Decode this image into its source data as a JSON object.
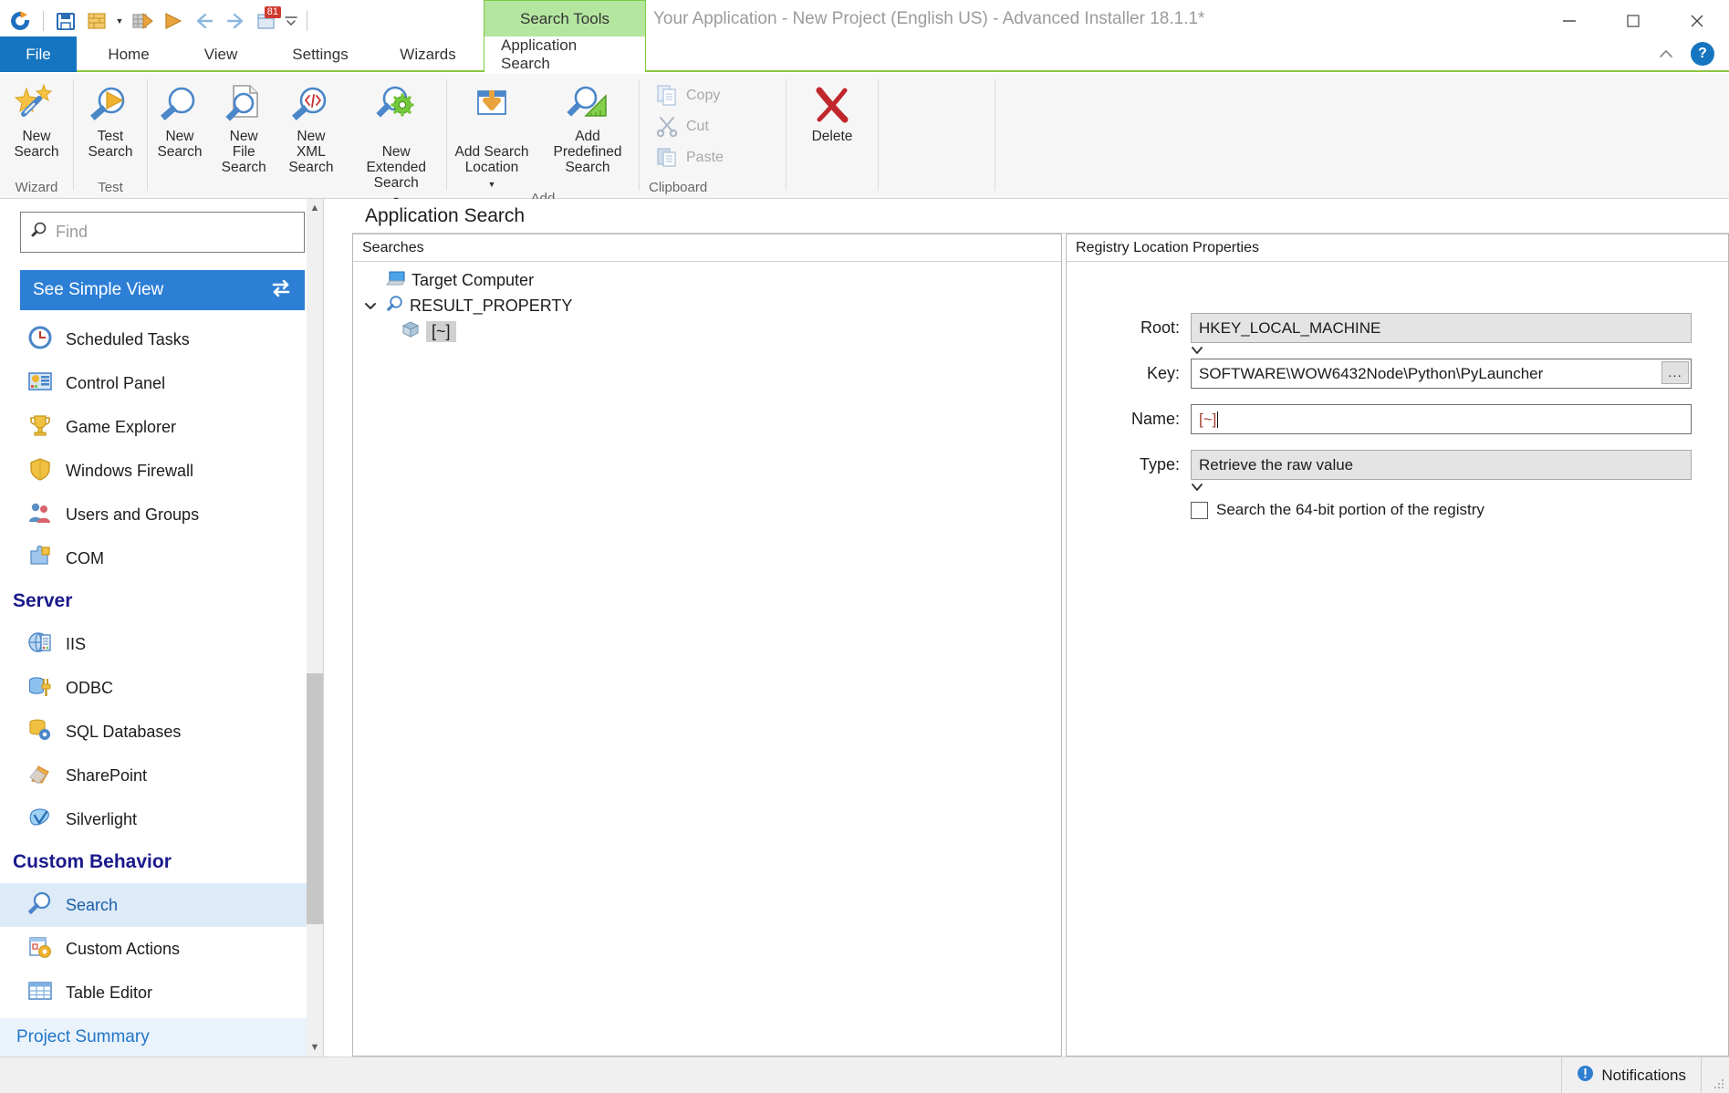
{
  "window": {
    "title": "Your Application - New Project (English US) - Advanced Installer 18.1.1*",
    "minimize_label": "Minimize",
    "maximize_label": "Maximize",
    "close_label": "Close",
    "help_label": "?",
    "collapse_ribbon_label": "Collapse Ribbon"
  },
  "quick_access": [
    {
      "name": "app-logo-icon",
      "label": "Advanced Installer"
    },
    {
      "name": "save-icon",
      "label": "Save"
    },
    {
      "name": "build-icon",
      "label": "Build"
    },
    {
      "name": "build-dropdown-icon",
      "label": "Build options"
    },
    {
      "name": "build-run-icon",
      "label": "Build and Run"
    },
    {
      "name": "run-icon",
      "label": "Run"
    },
    {
      "name": "back-icon",
      "label": "Back"
    },
    {
      "name": "forward-icon",
      "label": "Forward"
    },
    {
      "name": "badge-icon",
      "label": "81"
    },
    {
      "name": "qat-more-icon",
      "label": "Customize Quick Access Toolbar"
    }
  ],
  "quick_access_badge": "81",
  "contextual_tab_group": "Search Tools",
  "tabs": [
    {
      "label": "File",
      "active": false,
      "kind": "file"
    },
    {
      "label": "Home",
      "active": false,
      "kind": "normal"
    },
    {
      "label": "View",
      "active": false,
      "kind": "normal"
    },
    {
      "label": "Settings",
      "active": false,
      "kind": "normal"
    },
    {
      "label": "Wizards",
      "active": false,
      "kind": "normal"
    },
    {
      "label": "Application Search",
      "active": true,
      "kind": "contextual"
    }
  ],
  "ribbon": {
    "groups": [
      {
        "label": "Wizard",
        "buttons": [
          {
            "label": "New\nSearch",
            "icon": "wizard-star-wand-icon",
            "dropdown": false
          }
        ]
      },
      {
        "label": "Test",
        "buttons": [
          {
            "label": "Test\nSearch",
            "icon": "magnifier-play-icon",
            "dropdown": false
          }
        ]
      },
      {
        "label": "New",
        "buttons": [
          {
            "label": "New\nSearch",
            "icon": "magnifier-icon",
            "dropdown": false
          },
          {
            "label": "New File\nSearch",
            "icon": "file-magnifier-icon",
            "dropdown": false
          },
          {
            "label": "New XML\nSearch",
            "icon": "xml-magnifier-icon",
            "dropdown": false
          },
          {
            "label": "New Extended\nSearch",
            "icon": "magnifier-gear-icon",
            "dropdown": true
          }
        ]
      },
      {
        "label": "Add",
        "buttons": [
          {
            "label": "Add Search\nLocation",
            "icon": "download-tray-icon",
            "dropdown": true
          },
          {
            "label": "Add Predefined\nSearch",
            "icon": "magnifier-ruler-icon",
            "dropdown": false
          }
        ]
      },
      {
        "label": "Clipboard",
        "buttons": [
          {
            "label": "Copy",
            "icon": "copy-icon",
            "dropdown": false,
            "disabled": true
          },
          {
            "label": "Cut",
            "icon": "scissors-icon",
            "dropdown": false,
            "disabled": true
          },
          {
            "label": "Paste",
            "icon": "paste-icon",
            "dropdown": false,
            "disabled": true
          }
        ]
      },
      {
        "label": "",
        "buttons": [
          {
            "label": "Delete",
            "icon": "red-x-delete-icon",
            "dropdown": false
          }
        ]
      }
    ]
  },
  "sidebar": {
    "find": {
      "placeholder": "Find",
      "value": "",
      "icon": "search-icon"
    },
    "toggle_view": {
      "label": "See Simple View",
      "icon": "switch-arrows-icon"
    },
    "items": [
      {
        "label": "Scheduled Tasks",
        "icon": "clock-icon",
        "type": "item"
      },
      {
        "label": "Control Panel",
        "icon": "control-panel-icon",
        "type": "item"
      },
      {
        "label": "Game Explorer",
        "icon": "trophy-icon",
        "type": "item"
      },
      {
        "label": "Windows Firewall",
        "icon": "shield-icon",
        "type": "item"
      },
      {
        "label": "Users and Groups",
        "icon": "users-icon",
        "type": "item"
      },
      {
        "label": "COM",
        "icon": "puzzle-icon",
        "type": "item"
      },
      {
        "label": "Server",
        "type": "header"
      },
      {
        "label": "IIS",
        "icon": "iis-server-icon",
        "type": "item"
      },
      {
        "label": "ODBC",
        "icon": "odbc-plug-icon",
        "type": "item"
      },
      {
        "label": "SQL Databases",
        "icon": "database-gear-icon",
        "type": "item"
      },
      {
        "label": "SharePoint",
        "icon": "sharepoint-icon",
        "type": "item"
      },
      {
        "label": "Silverlight",
        "icon": "silverlight-icon",
        "type": "item"
      },
      {
        "label": "Custom Behavior",
        "type": "header"
      },
      {
        "label": "Search",
        "icon": "magnifier-icon",
        "type": "item",
        "selected": true
      },
      {
        "label": "Custom Actions",
        "icon": "custom-actions-icon",
        "type": "item"
      },
      {
        "label": "Table Editor",
        "icon": "table-icon",
        "type": "item"
      }
    ],
    "footer": {
      "label": "Project Summary"
    }
  },
  "main": {
    "page_title": "Application Search",
    "searches_pane": {
      "header": "Searches",
      "tree": [
        {
          "label": "Target Computer",
          "icon": "computer-icon",
          "depth": 0,
          "twisty": "none",
          "selected": false
        },
        {
          "label": "RESULT_PROPERTY",
          "icon": "magnifier-icon",
          "depth": 0,
          "twisty": "expanded",
          "selected": false
        },
        {
          "label": "[~]",
          "icon": "registry-icon",
          "depth": 1,
          "twisty": "none",
          "selected": true
        }
      ]
    },
    "properties_pane": {
      "header": "Registry Location Properties",
      "fields": {
        "root": {
          "label": "Root:",
          "value": "HKEY_LOCAL_MACHINE",
          "control": "combo"
        },
        "key": {
          "label": "Key:",
          "value": "SOFTWARE\\WOW6432Node\\Python\\PyLauncher",
          "control": "text-browse",
          "browse_label": "..."
        },
        "name": {
          "label": "Name:",
          "value": "[~]",
          "control": "text"
        },
        "type": {
          "label": "Type:",
          "value": "Retrieve the raw value",
          "control": "combo"
        }
      },
      "checkbox": {
        "label": "Search the 64-bit portion of the registry",
        "checked": false
      }
    }
  },
  "statusbar": {
    "notifications_label": "Notifications",
    "notifications_icon": "info-icon"
  },
  "colors": {
    "accent_blue": "#1675c0",
    "contextual_green": "#8cc63f",
    "contextual_green_fill": "#b5e6a0",
    "selection_blue": "#2d7fd6",
    "header_navy": "#1a1a8c",
    "delete_red": "#c0272d"
  }
}
